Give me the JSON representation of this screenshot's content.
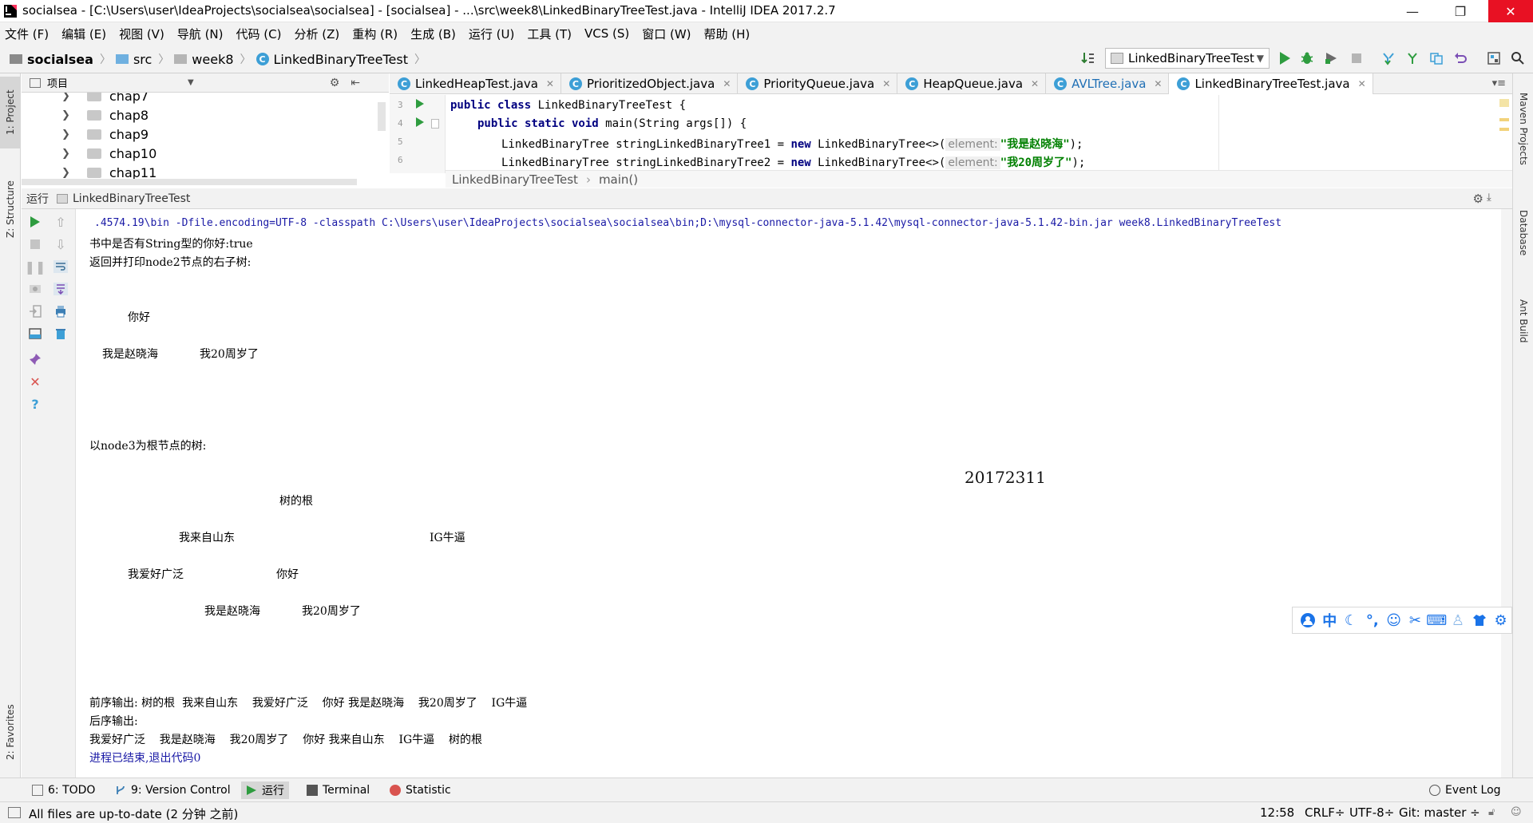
{
  "window": {
    "title": "socialsea - [C:\\Users\\user\\IdeaProjects\\socialsea\\socialsea] - [socialsea] - ...\\src\\week8\\LinkedBinaryTreeTest.java - IntelliJ IDEA 2017.2.7",
    "minimize": "—",
    "restore": "❐",
    "close": "✕"
  },
  "menu": [
    "文件 (F)",
    "编辑 (E)",
    "视图 (V)",
    "导航 (N)",
    "代码 (C)",
    "分析 (Z)",
    "重构 (R)",
    "生成 (B)",
    "运行 (U)",
    "工具 (T)",
    "VCS (S)",
    "窗口 (W)",
    "帮助 (H)"
  ],
  "breadcrumb": [
    "socialsea",
    "src",
    "week8",
    "LinkedBinaryTreeTest"
  ],
  "run_config": "LinkedBinaryTreeTest",
  "project_panel": {
    "header": "项目",
    "items": [
      "chap7",
      "chap8",
      "chap9",
      "chap10",
      "chap11"
    ]
  },
  "editor_tabs": [
    {
      "label": "LinkedHeapTest.java"
    },
    {
      "label": "PrioritizedObject.java"
    },
    {
      "label": "PriorityQueue.java"
    },
    {
      "label": "HeapQueue.java"
    },
    {
      "label": "AVLTree.java"
    },
    {
      "label": "LinkedBinaryTreeTest.java"
    }
  ],
  "editor": {
    "line_numbers": [
      "3",
      "4",
      "5",
      "6"
    ],
    "line3": {
      "kw": "public class",
      "rest": " LinkedBinaryTreeTest {"
    },
    "line4": {
      "kw": "public static void",
      "rest": " main(String args[]) {"
    },
    "line5": {
      "pre": "LinkedBinaryTree stringLinkedBinaryTree1 = ",
      "kw": "new",
      "mid": " LinkedBinaryTree<>(",
      "hint": "element:",
      "str": "\"我是赵晓海\"",
      "end": ");"
    },
    "line6": {
      "pre": "LinkedBinaryTree stringLinkedBinaryTree2 = ",
      "kw": "new",
      "mid": " LinkedBinaryTree<>(",
      "hint": "element:",
      "str": "\"我20周岁了\"",
      "end": ");"
    },
    "crumb_class": "LinkedBinaryTreeTest",
    "crumb_method": "main()"
  },
  "run_panel": {
    "label": "运行",
    "config": "LinkedBinaryTreeTest"
  },
  "console": {
    "cmd": ".4574.19\\bin -Dfile.encoding=UTF-8 -classpath C:\\Users\\user\\IdeaProjects\\socialsea\\socialsea\\bin;D:\\mysql-connector-java-5.1.42\\mysql-connector-java-5.1.42-bin.jar week8.LinkedBinaryTreeTest",
    "l1": "书中是否有String型的你好:true",
    "l2": "返回并打印node2节点的右子树:",
    "t1_root": "你好",
    "t1_left": "我是赵晓海",
    "t1_right": "我20周岁了",
    "l3": "以node3为根节点的树:",
    "watermark": "20172311",
    "t2_root": "树的根",
    "t2_l": "我来自山东",
    "t2_r": "IG牛逼",
    "t2_ll": "我爱好广泛",
    "t2_lr": "你好",
    "t2_lrl": "我是赵晓海",
    "t2_lrr": "我20周岁了",
    "pre": "前序输出: 树的根  我来自山东    我爱好广泛    你好 我是赵晓海    我20周岁了    IG牛逼",
    "post_label": "后序输出:",
    "post": "我爱好广泛    我是赵晓海    我20周岁了    你好 我来自山东    IG牛逼    树的根",
    "exit": "进程已结束,退出代码0"
  },
  "left_tabs": {
    "project": "1: Project",
    "structure": "Z: Structure",
    "favorites": "2: Favorites"
  },
  "right_tabs": {
    "maven": "Maven Projects",
    "database": "Database",
    "ant": "Ant Build"
  },
  "bottom_tabs": {
    "todo": "6: TODO",
    "vcs": "9: Version Control",
    "run": "运行",
    "terminal": "Terminal",
    "statistic": "Statistic",
    "event_log": "Event Log"
  },
  "status": {
    "message": "All files are up-to-date (2 分钟 之前)",
    "position": "12:58",
    "line_sep": "CRLF÷",
    "encoding": "UTF-8÷",
    "git": "Git: master ÷"
  },
  "ime": [
    "中"
  ],
  "colors": {
    "accent": "#3d9fd6",
    "run_green": "#2e9c3f",
    "close_red": "#e81123",
    "console_blue": "#1a1aa6"
  }
}
